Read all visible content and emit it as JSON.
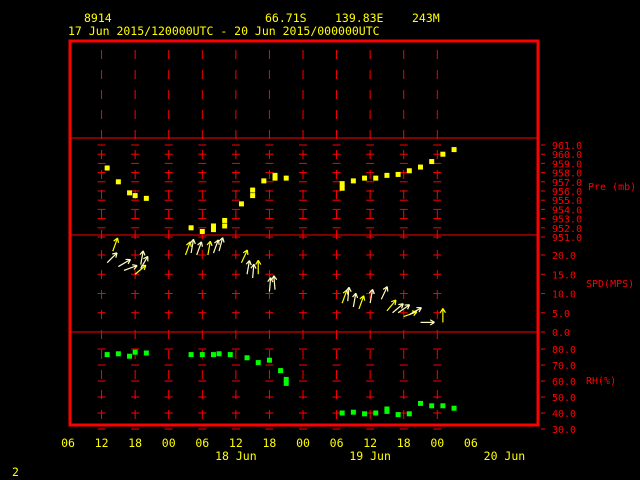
{
  "header": {
    "station_id": "8914",
    "latitude": "66.71S",
    "longitude": "139.83E",
    "elevation": "243M",
    "period": "17 Jun 2015/120000UTC - 20 Jun 2015/000000UTC"
  },
  "page_number": "2",
  "colors": {
    "background": "#000000",
    "frame": "#ff0000",
    "grid": "#ff0000",
    "axis_text": "#ffff00",
    "right_labels": "#ff0000",
    "pressure": "#ffff00",
    "wind": "#ffff00",
    "wind_light": "#ffffc0",
    "rh": "#00ff00"
  },
  "x_axis": {
    "tick_labels": [
      "06",
      "12",
      "18",
      "00",
      "06",
      "12",
      "18",
      "00",
      "06",
      "12",
      "18",
      "00",
      "06"
    ],
    "date_labels": [
      {
        "label": "18 Jun",
        "at_hour": 36
      },
      {
        "label": "19 Jun",
        "at_hour": 60
      },
      {
        "label": "20 Jun",
        "at_hour": 84
      }
    ],
    "range_hours_from_17jun_00utc": [
      6,
      90
    ]
  },
  "chart_data": [
    {
      "type": "scatter",
      "title": "Pre (mb)",
      "ylabel": "Pre (mb)",
      "y_ticks": [
        "961.0",
        "960.0",
        "959.0",
        "958.0",
        "957.0",
        "956.0",
        "955.0",
        "954.0",
        "953.0",
        "952.0",
        "951.0"
      ],
      "ylim": [
        951,
        961
      ],
      "x_units": "hours since 17 Jun 2015 00UTC",
      "points": [
        [
          13,
          958.5
        ],
        [
          15,
          957.0
        ],
        [
          17,
          955.8
        ],
        [
          18,
          955.5
        ],
        [
          20,
          955.2
        ],
        [
          28,
          952.0
        ],
        [
          30,
          951.6
        ],
        [
          32,
          952.2
        ],
        [
          32,
          951.8
        ],
        [
          34,
          952.8
        ],
        [
          34,
          952.2
        ],
        [
          37,
          954.6
        ],
        [
          39,
          955.5
        ],
        [
          39,
          956.1
        ],
        [
          41,
          957.1
        ],
        [
          43,
          957.4
        ],
        [
          43,
          957.7
        ],
        [
          45,
          957.4
        ],
        [
          55,
          956.8
        ],
        [
          55,
          956.3
        ],
        [
          57,
          957.1
        ],
        [
          59,
          957.4
        ],
        [
          61,
          957.4
        ],
        [
          63,
          957.7
        ],
        [
          65,
          957.8
        ],
        [
          67,
          958.2
        ],
        [
          69,
          958.6
        ],
        [
          71,
          959.2
        ],
        [
          73,
          960.0
        ],
        [
          75,
          960.5
        ]
      ]
    },
    {
      "type": "scatter",
      "title": "SPD(MPS)",
      "ylabel": "SPD(MPS)",
      "y_ticks": [
        "20.0",
        "15.0",
        "10.0",
        "5.0",
        "0.0"
      ],
      "ylim": [
        0,
        20
      ],
      "x_units": "hours since 17 Jun 2015 00UTC",
      "wind_barbs": [
        {
          "x": 13,
          "speed": 18.0,
          "dir": 225
        },
        {
          "x": 14,
          "speed": 21.0,
          "dir": 200
        },
        {
          "x": 15,
          "speed": 17.0,
          "dir": 240
        },
        {
          "x": 16,
          "speed": 16.0,
          "dir": 250
        },
        {
          "x": 18,
          "speed": 15.0,
          "dir": 230
        },
        {
          "x": 19,
          "speed": 16.5,
          "dir": 210
        },
        {
          "x": 19,
          "speed": 17.5,
          "dir": 190
        },
        {
          "x": 27,
          "speed": 20.0,
          "dir": 200
        },
        {
          "x": 28,
          "speed": 20.5,
          "dir": 190
        },
        {
          "x": 29,
          "speed": 20.0,
          "dir": 200
        },
        {
          "x": 31,
          "speed": 20.0,
          "dir": 190
        },
        {
          "x": 32,
          "speed": 20.5,
          "dir": 200
        },
        {
          "x": 33,
          "speed": 21.0,
          "dir": 195
        },
        {
          "x": 37,
          "speed": 18.0,
          "dir": 205
        },
        {
          "x": 38,
          "speed": 15.0,
          "dir": 190
        },
        {
          "x": 39,
          "speed": 14.0,
          "dir": 185
        },
        {
          "x": 40,
          "speed": 15.0,
          "dir": 180
        },
        {
          "x": 42,
          "speed": 10.5,
          "dir": 185
        },
        {
          "x": 43,
          "speed": 11.0,
          "dir": 175
        },
        {
          "x": 55,
          "speed": 7.5,
          "dir": 200
        },
        {
          "x": 56,
          "speed": 8.0,
          "dir": 185
        },
        {
          "x": 57,
          "speed": 6.5,
          "dir": 190
        },
        {
          "x": 58,
          "speed": 6.0,
          "dir": 200
        },
        {
          "x": 60,
          "speed": 7.5,
          "dir": 190
        },
        {
          "x": 62,
          "speed": 8.5,
          "dir": 205
        },
        {
          "x": 63,
          "speed": 5.5,
          "dir": 220
        },
        {
          "x": 64,
          "speed": 5.0,
          "dir": 230
        },
        {
          "x": 65,
          "speed": 5.0,
          "dir": 235
        },
        {
          "x": 66,
          "speed": 4.0,
          "dir": 250
        },
        {
          "x": 67,
          "speed": 4.5,
          "dir": 240
        },
        {
          "x": 69,
          "speed": 2.5,
          "dir": 270
        },
        {
          "x": 73,
          "speed": 2.5,
          "dir": 180
        }
      ]
    },
    {
      "type": "scatter",
      "title": "RH(%)",
      "ylabel": "RH(%)",
      "y_ticks": [
        "80.0",
        "70.0",
        "60.0",
        "50.0",
        "40.0",
        "30.0"
      ],
      "ylim": [
        30,
        80
      ],
      "x_units": "hours since 17 Jun 2015 00UTC",
      "points": [
        [
          13,
          76.5
        ],
        [
          15,
          77.0
        ],
        [
          17,
          75.5
        ],
        [
          18,
          78.0
        ],
        [
          20,
          77.5
        ],
        [
          28,
          76.5
        ],
        [
          30,
          76.5
        ],
        [
          32,
          76.5
        ],
        [
          33,
          77.0
        ],
        [
          35,
          76.5
        ],
        [
          38,
          74.5
        ],
        [
          40,
          71.5
        ],
        [
          42,
          73.0
        ],
        [
          44,
          66.5
        ],
        [
          45,
          58.5
        ],
        [
          45,
          61.0
        ],
        [
          55,
          40.0
        ],
        [
          57,
          40.5
        ],
        [
          59,
          39.5
        ],
        [
          61,
          40.0
        ],
        [
          63,
          41.0
        ],
        [
          63,
          42.5
        ],
        [
          65,
          39.0
        ],
        [
          67,
          39.5
        ],
        [
          69,
          46.0
        ],
        [
          71,
          44.5
        ],
        [
          73,
          44.5
        ],
        [
          75,
          43.0
        ]
      ]
    }
  ]
}
